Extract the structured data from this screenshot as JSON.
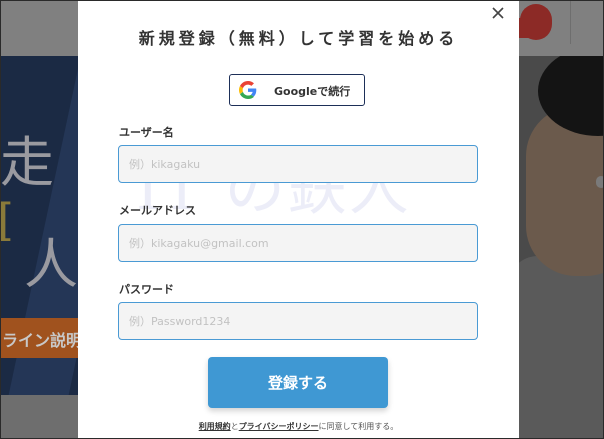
{
  "background": {
    "hero_chars": [
      "走",
      "I",
      "人"
    ],
    "banner_text": "ライン説明"
  },
  "modal": {
    "title": "新規登録（無料）して学習を始める",
    "close_icon": "close-icon",
    "google_button": {
      "icon": "google-g-icon",
      "label": "Googleで続行"
    },
    "fields": {
      "username": {
        "label": "ユーザー名",
        "placeholder": "例）kikagaku",
        "value": ""
      },
      "email": {
        "label": "メールアドレス",
        "placeholder": "例）kikagaku@gmail.com",
        "value": ""
      },
      "password": {
        "label": "パスワード",
        "placeholder": "例）Password1234",
        "value": ""
      }
    },
    "watermark": "IT の鉄人",
    "submit_label": "登録する",
    "terms": {
      "terms_link": "利用規約",
      "and": "と",
      "privacy_link": "プライバシーポリシー",
      "suffix": "に同意して利用する。"
    }
  },
  "colors": {
    "accent": "#3f98d3",
    "google_border": "#1d2f58",
    "input_border": "#4a9ad4"
  }
}
